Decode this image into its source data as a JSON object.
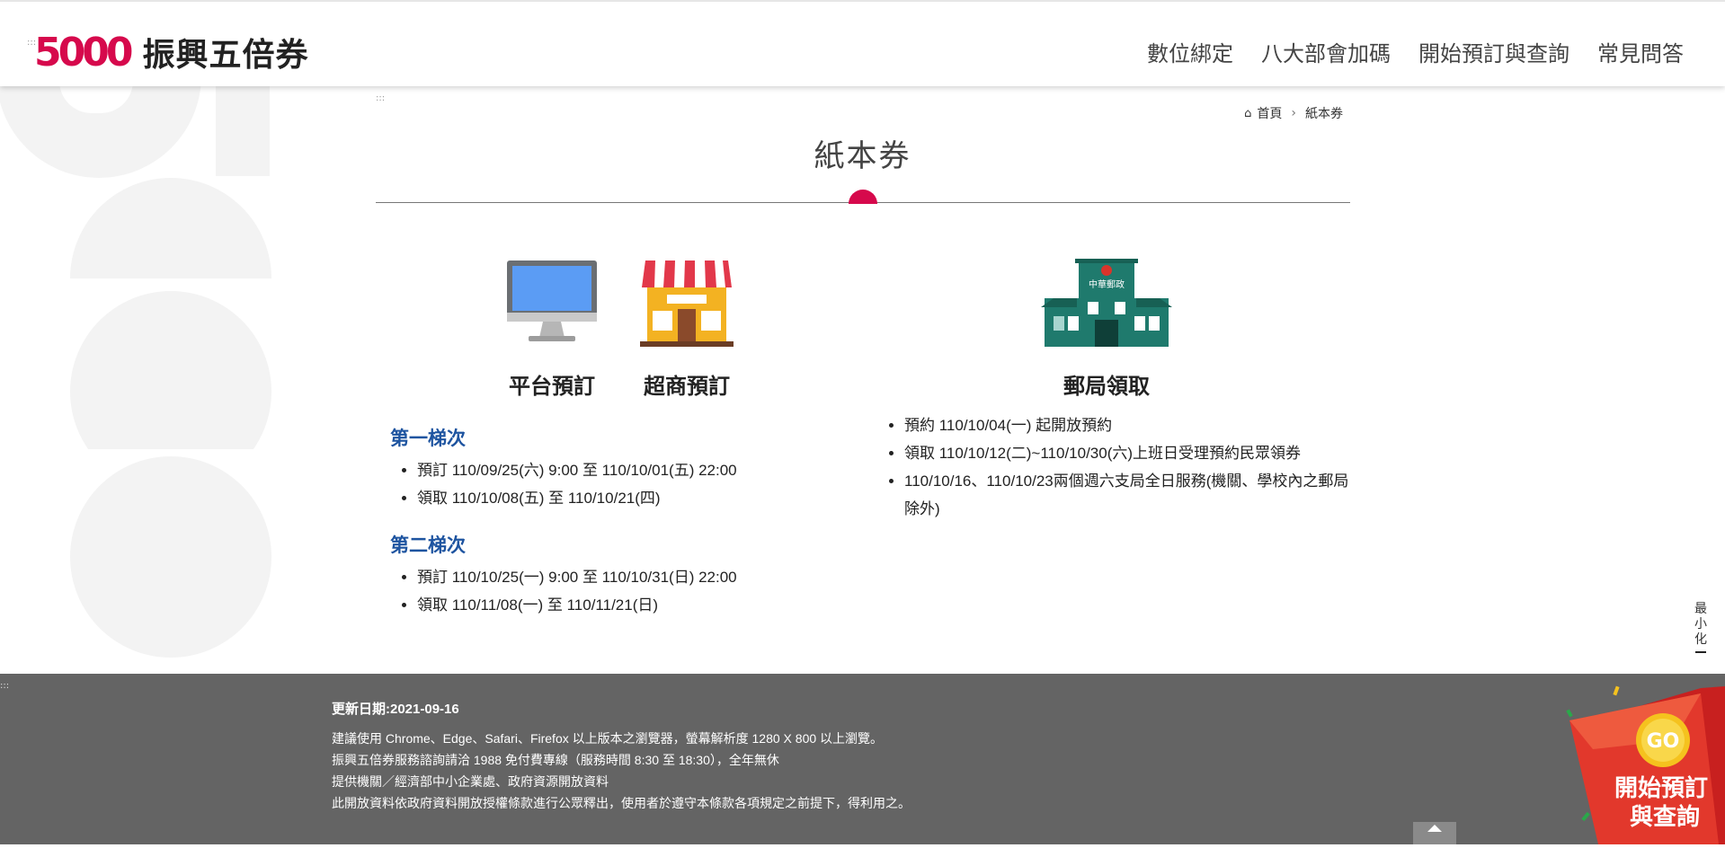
{
  "header": {
    "logo_number": "5000",
    "logo_text": "振興五倍券",
    "nav": [
      "數位綁定",
      "八大部會加碼",
      "開始預訂與查詢",
      "常見問答"
    ]
  },
  "breadcrumb": {
    "home": "首頁",
    "current": "紙本券"
  },
  "page_title": "紙本券",
  "methods": {
    "platform_label": "平台預訂",
    "store_label": "超商預訂",
    "post_label": "郵局領取",
    "post_sign": "中華郵政"
  },
  "batches": [
    {
      "title": "第一梯次",
      "items": [
        "預訂 110/09/25(六) 9:00 至 110/10/01(五) 22:00",
        "領取 110/10/08(五) 至 110/10/21(四)"
      ]
    },
    {
      "title": "第二梯次",
      "items": [
        "預訂 110/10/25(一) 9:00 至 110/10/31(日) 22:00",
        "領取 110/11/08(一) 至 110/11/21(日)"
      ]
    }
  ],
  "post_items": [
    "預約 110/10/04(一) 起開放預約",
    "領取 110/10/12(二)~110/10/30(六)上班日受理預約民眾領券",
    "110/10/16、110/10/23兩個週六支局全日服務(機關、學校內之郵局除外)"
  ],
  "minimize_label": "最小化",
  "footer": {
    "updated": "更新日期:2021-09-16",
    "lines": [
      "建議使用 Chrome、Edge、Safari、Firefox 以上版本之瀏覽器，螢幕解析度 1280 X 800 以上瀏覽。",
      "振興五倍券服務諮詢請洽 1988 免付費專線（服務時間 8:30 至 18:30），全年無休",
      "提供機關／經濟部中小企業處、政府資源開放資料",
      "此開放資料依政府資料開放授權條款進行公眾釋出，使用者於遵守本條款各項規定之前提下，得利用之。"
    ]
  },
  "promo": {
    "badge": "GO",
    "line1": "開始預訂",
    "line2": "與查詢"
  },
  "colors": {
    "brand": "#d6094c",
    "batch_title": "#1e54a0",
    "footer_bg": "#646464"
  }
}
